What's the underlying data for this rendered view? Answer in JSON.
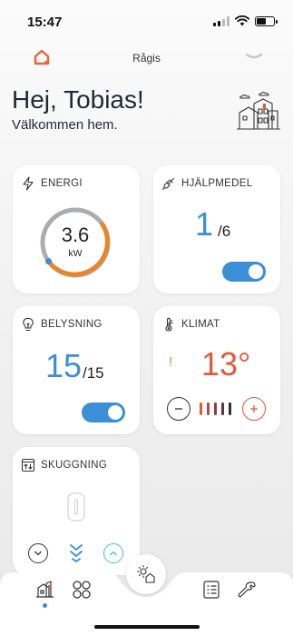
{
  "status_bar": {
    "time": "15:47"
  },
  "header": {
    "site_name": "Rågis"
  },
  "greeting": {
    "title": "Hej, Tobias!",
    "subtitle": "Välkommen hem."
  },
  "cards": {
    "energi": {
      "title": "ENERGI",
      "value": "3.6",
      "unit": "kW",
      "gauge_fraction": 0.5
    },
    "hjalpmedel": {
      "title": "HJÄLPMEDEL",
      "count": "1",
      "total": "/6",
      "toggle_on": true
    },
    "belysning": {
      "title": "BELYSNING",
      "count": "15",
      "total": "/15",
      "toggle_on": true
    },
    "klimat": {
      "title": "KLIMAT",
      "temperature": "13°",
      "alert": "!",
      "level_bars": 5
    },
    "skuggning": {
      "title": "SKUGGNING"
    }
  },
  "colors": {
    "accent_blue": "#3a8fd6",
    "accent_orange": "#e8852b",
    "accent_red": "#e05a3a",
    "teal": "#45c1b4",
    "brand_orange": "#e8623a"
  }
}
